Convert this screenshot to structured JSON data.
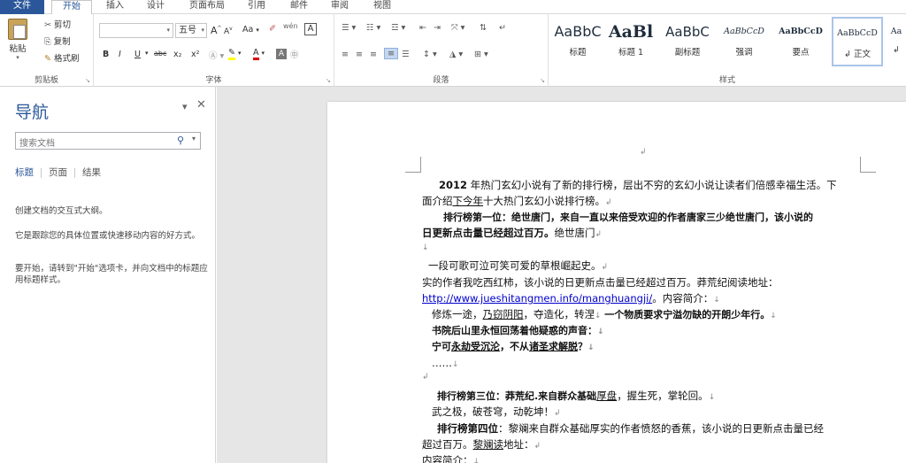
{
  "menu": {
    "file": "文件",
    "tabs": [
      "开始",
      "插入",
      "设计",
      "页面布局",
      "引用",
      "邮件",
      "审阅",
      "视图"
    ]
  },
  "clipboard": {
    "paste": "粘贴",
    "cut": "剪切",
    "copy": "复制",
    "format_painter": "格式刷",
    "label": "剪贴板"
  },
  "font": {
    "name_value": "",
    "size_value": "五号",
    "grow": "A",
    "shrink": "A",
    "change_case": "Aa",
    "phonetic": "wén",
    "bold": "B",
    "italic": "I",
    "underline": "U",
    "strike": "abc",
    "sub": "x₂",
    "sup": "x²",
    "label": "字体"
  },
  "paragraph": {
    "label": "段落"
  },
  "styles": {
    "items": [
      {
        "sample": "AaBbC",
        "name": "标题"
      },
      {
        "sample": "AaBl",
        "name": "标题 1"
      },
      {
        "sample": "AaBbC",
        "name": "副标题"
      },
      {
        "sample": "AaBbCcD",
        "name": "强调"
      },
      {
        "sample": "AaBbCcD",
        "name": "要点"
      },
      {
        "sample": "AaBbCcD",
        "name": "↲ 正文"
      },
      {
        "sample": "Aa",
        "name": "↲"
      }
    ],
    "label": "样式"
  },
  "nav": {
    "title": "导航",
    "search_placeholder": "搜索文档",
    "tabs": [
      "标题",
      "页面",
      "结果"
    ],
    "text1": "创建文档的交互式大纲。",
    "text2": "它是跟踪您的具体位置或快速移动内容的好方式。",
    "text3": "要开始，请转到\"开始\"选项卡，并向文档中的标题应用标题样式。"
  },
  "doc": {
    "l1a": "2012",
    "l1b": " 年热门玄幻小说有了新的排行榜，层出不穷的玄幻小说让读者们倍感幸福生活。下",
    "l2a": "面介绍",
    "l2b": "下今年",
    "l2c": "十大热门玄幻小说排行榜。",
    "l3": "排行榜第一位：绝世唐门，来自一直以来倍受欢迎的作者唐家三少绝世唐门，该小说的",
    "l4a": "日更新点击量已经超过百万。",
    "l4b": "绝世唐门",
    "l6": "一段可歌可泣可笑可爱的草根崛起史。",
    "l7": "实的作者我吃西红柿，该小说的日更新点击量已经超过百万。莽荒纪阅读地址：",
    "l8a": "http://www.jueshitangmen.info/manghuangji/",
    "l8b": "。内容简介：",
    "l9a": "修炼一途，",
    "l9b": "乃窃阴阳",
    "l9c": "，夺造化，转涅",
    "l9d": "一个物质要求宁溢勿缺的开朗少年行。",
    "l10": "书院后山里永恒回荡着他疑惑的声音：",
    "l11a": "宁可",
    "l11b": "永劫受沉沦",
    "l11c": "，不从",
    "l11d": "诸圣求解脱",
    "l11e": "？",
    "l12": "……",
    "l14a": "排行榜第三位：莽荒纪.来自群众基础",
    "l14b": "厚盘",
    "l14c": "，握生死，掌轮回。",
    "l15": "武之极，破苍穹，动乾坤！",
    "l16a": "排行榜第四位",
    "l16b": "：黎斓来自群众基础厚实的作者愤怒的香蕉，该小说的日更新点击量已经",
    "l17a": "超过百万。",
    "l17b": "黎斓读",
    "l17c": "地址：",
    "l18": "内容简介："
  }
}
